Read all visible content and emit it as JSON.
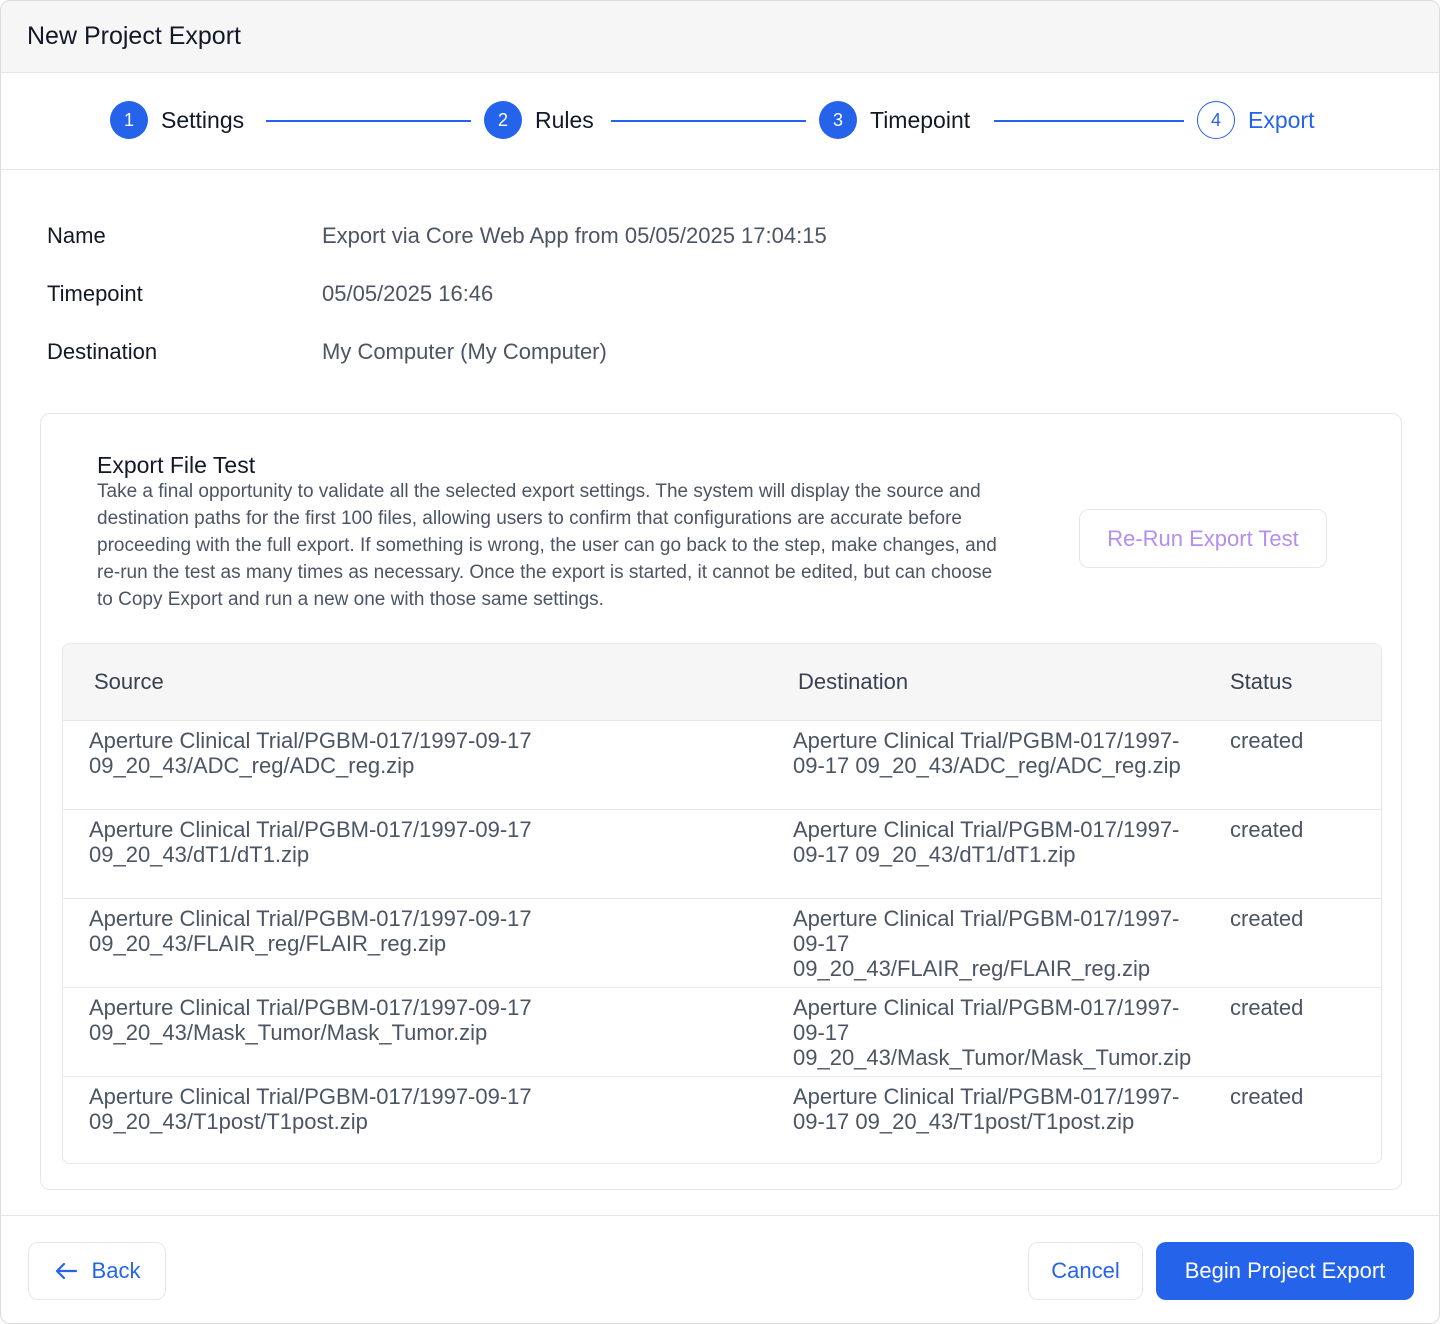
{
  "dialog": {
    "title": "New Project Export"
  },
  "stepper": {
    "steps": [
      {
        "number": "1",
        "label": "Settings",
        "state": "complete"
      },
      {
        "number": "2",
        "label": "Rules",
        "state": "complete"
      },
      {
        "number": "3",
        "label": "Timepoint",
        "state": "complete"
      },
      {
        "number": "4",
        "label": "Export",
        "state": "current"
      }
    ]
  },
  "summary": {
    "name_label": "Name",
    "name_value": "Export via Core Web App from 05/05/2025 17:04:15",
    "timepoint_label": "Timepoint",
    "timepoint_value": "05/05/2025 16:46",
    "destination_label": "Destination",
    "destination_value": "My Computer (My Computer)"
  },
  "export_test": {
    "title": "Export File Test",
    "description": "Take a final opportunity to validate all the selected export settings. The system will display the source and destination paths for the first 100 files, allowing users to confirm that configurations are accurate before proceeding with the full export. If something is wrong, the user can go back to the step, make changes, and re-run the test as many times as necessary. Once the export is started, it cannot be edited, but can choose to Copy Export and run a new one with those same settings.",
    "rerun_label": "Re-Run Export Test",
    "table": {
      "headers": {
        "source": "Source",
        "destination": "Destination",
        "status": "Status"
      },
      "rows": [
        {
          "source": "Aperture Clinical Trial/PGBM-017/1997-09-17 09_20_43/ADC_reg/ADC_reg.zip",
          "destination": "Aperture Clinical Trial/PGBM-017/1997-09-17 09_20_43/ADC_reg/ADC_reg.zip",
          "status": "created"
        },
        {
          "source": "Aperture Clinical Trial/PGBM-017/1997-09-17 09_20_43/dT1/dT1.zip",
          "destination": "Aperture Clinical Trial/PGBM-017/1997-09-17 09_20_43/dT1/dT1.zip",
          "status": "created"
        },
        {
          "source": "Aperture Clinical Trial/PGBM-017/1997-09-17 09_20_43/FLAIR_reg/FLAIR_reg.zip",
          "destination": "Aperture Clinical Trial/PGBM-017/1997-09-17 09_20_43/FLAIR_reg/FLAIR_reg.zip",
          "status": "created"
        },
        {
          "source": "Aperture Clinical Trial/PGBM-017/1997-09-17 09_20_43/Mask_Tumor/Mask_Tumor.zip",
          "destination": "Aperture Clinical Trial/PGBM-017/1997-09-17 09_20_43/Mask_Tumor/Mask_Tumor.zip",
          "status": "created"
        },
        {
          "source": "Aperture Clinical Trial/PGBM-017/1997-09-17 09_20_43/T1post/T1post.zip",
          "destination": "Aperture Clinical Trial/PGBM-017/1997-09-17 09_20_43/T1post/T1post.zip",
          "status": "created"
        }
      ]
    }
  },
  "footer": {
    "back_label": "Back",
    "back_icon": "arrow-left-icon",
    "cancel_label": "Cancel",
    "begin_label": "Begin Project Export"
  },
  "colors": {
    "primary": "#2563eb",
    "rerun_text": "#b48ef0",
    "header_bg": "#f6f6f7"
  }
}
